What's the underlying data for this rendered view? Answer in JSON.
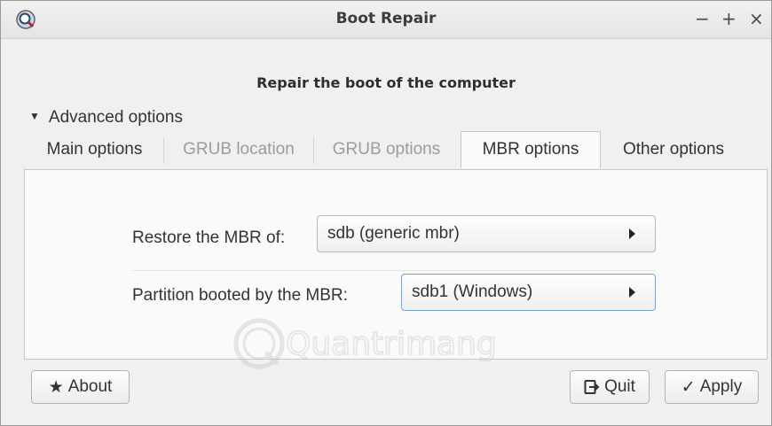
{
  "window": {
    "title": "Boot Repair",
    "controls": {
      "minimize": "−",
      "maximize": "+",
      "close": "×"
    }
  },
  "main": {
    "heading": "Repair the boot of the computer",
    "expander": {
      "label": "Advanced options",
      "expanded": true,
      "icon": "triangle-down-icon"
    },
    "tabs": [
      {
        "label": "Main options",
        "state": "normal"
      },
      {
        "label": "GRUB location",
        "state": "disabled"
      },
      {
        "label": "GRUB options",
        "state": "disabled"
      },
      {
        "label": "MBR options",
        "state": "active"
      },
      {
        "label": "Other options",
        "state": "normal"
      }
    ],
    "fields": {
      "restore_mbr": {
        "label": "Restore the MBR of:",
        "value": "sdb (generic mbr)"
      },
      "partition_booted": {
        "label": "Partition booted by the MBR:",
        "value": "sdb1 (Windows)"
      }
    }
  },
  "watermark": {
    "text": "Quantrimang"
  },
  "buttons": {
    "about": {
      "label": "About",
      "icon": "star-icon"
    },
    "quit": {
      "label": "Quit",
      "icon": "exit-icon"
    },
    "apply": {
      "label": "Apply",
      "icon": "checkmark-icon"
    }
  },
  "colors": {
    "window_bg": "#f0f0f0",
    "panel_bg": "#fafafa",
    "focus_border": "#7da2ce",
    "disabled_text": "#9c9c9c"
  }
}
